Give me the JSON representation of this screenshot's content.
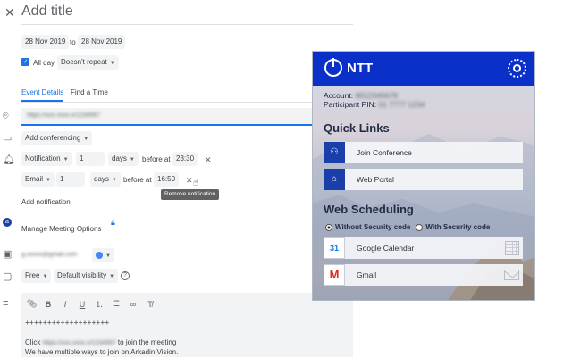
{
  "event": {
    "close_icon": "close-icon",
    "title_placeholder": "Add title",
    "start_date": "28 Nov 2019",
    "to_label": "to",
    "end_date": "28 Nov 2019",
    "all_day_label": "All day",
    "repeat_label": "Doesn't repeat",
    "tabs": [
      {
        "label": "Event Details",
        "active": true
      },
      {
        "label": "Find a Time",
        "active": false
      }
    ],
    "location_value": "https://xxx.xxxx.x/1234567",
    "conferencing_label": "Add conferencing",
    "notifications": [
      {
        "type": "Notification",
        "amount": "1",
        "unit": "days",
        "before_at": "before at",
        "time": "23:30"
      },
      {
        "type": "Email",
        "amount": "1",
        "unit": "days",
        "before_at": "before at",
        "time": "16:50"
      }
    ],
    "tooltip": "Remove notification",
    "add_notification_label": "Add notification",
    "manage_meeting_label": "Manage Meeting Options",
    "calendar_owner": "g.xxxxx@gmail.com",
    "calendar_color": "#4285f4",
    "busy_label": "Free",
    "visibility_label": "Default visibility",
    "description": {
      "line_plus": "+++++++++++++++++++",
      "click_prefix": "Click",
      "click_link": "https://xxx.xxxx.x/1234567",
      "click_suffix": "to join the meeting",
      "line_ways": "We have multiple ways to join on Arkadin Vision."
    }
  },
  "ntt": {
    "brand": "NTT",
    "account_label": "Account:",
    "account_value": "9012345678",
    "pin_label": "Participant PIN:",
    "pin_value": "01 7777 1234",
    "quick_links_title": "Quick Links",
    "quick_links": [
      {
        "label": "Join Conference",
        "icon": "conference-icon",
        "color": "#1a3fa8"
      },
      {
        "label": "Web Portal",
        "icon": "house-icon",
        "color": "#1a3fa8"
      }
    ],
    "web_scheduling_title": "Web Scheduling",
    "options": [
      {
        "label": "Without Security code",
        "selected": true
      },
      {
        "label": "With Security code",
        "selected": false
      }
    ],
    "calendars": [
      {
        "label": "Google Calendar",
        "icon": "google-calendar-icon",
        "badge": "31"
      },
      {
        "label": "Gmail",
        "icon": "gmail-icon",
        "badge": "M"
      }
    ]
  }
}
